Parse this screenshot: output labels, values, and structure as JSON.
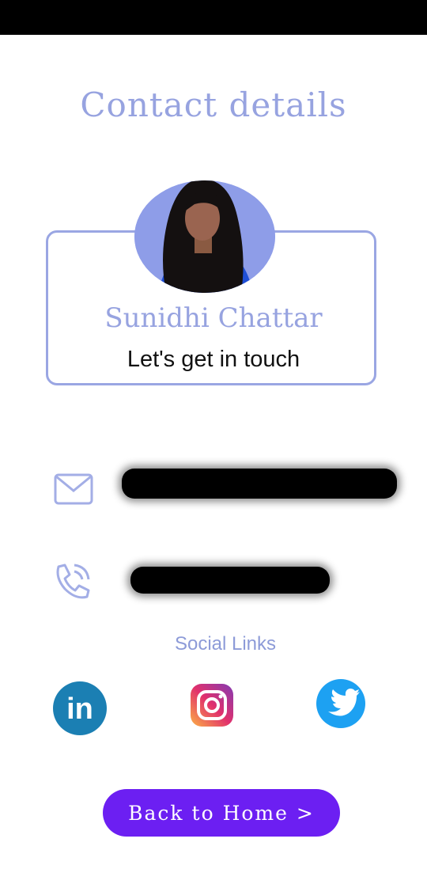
{
  "page": {
    "title": "Contact details"
  },
  "profile": {
    "name": "Sunidhi Chattar",
    "tagline": "Let's get in touch",
    "avatar_icon": "profile-photo",
    "avatar_bg_color": "#8e9de8"
  },
  "contacts": {
    "email_icon": "mail-icon",
    "phone_icon": "phone-call-icon",
    "email_value_state": "redacted",
    "phone_value_state": "redacted"
  },
  "social": {
    "title": "Social Links",
    "links": [
      {
        "icon": "linkedin-icon",
        "color": "#1b7fb3"
      },
      {
        "icon": "instagram-icon",
        "color": "#d6336c"
      },
      {
        "icon": "twitter-icon",
        "color": "#1da1f2"
      }
    ]
  },
  "actions": {
    "back_home_label": "Back to Home >"
  },
  "colors": {
    "accent": "#97a3e0",
    "button": "#6c1ff2"
  }
}
